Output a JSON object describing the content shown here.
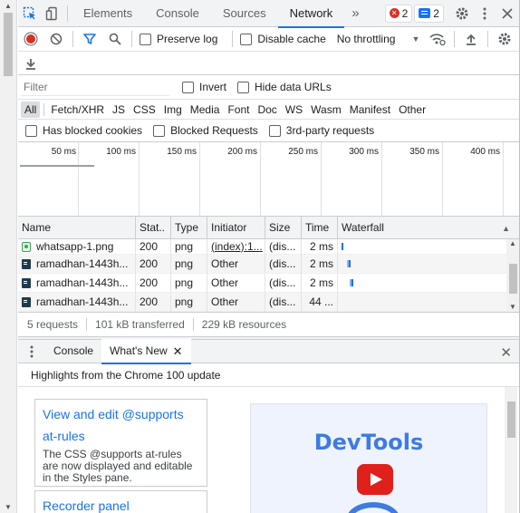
{
  "tabs": {
    "items": [
      "Elements",
      "Console",
      "Sources",
      "Network"
    ],
    "active": "Network",
    "more": "»",
    "error_count": "2",
    "message_count": "2"
  },
  "toolbar": {
    "preserve_log": "Preserve log",
    "disable_cache": "Disable cache",
    "throttling": "No throttling"
  },
  "filter": {
    "placeholder": "Filter",
    "invert": "Invert",
    "hide_data_urls": "Hide data URLs"
  },
  "type_filters": [
    "All",
    "Fetch/XHR",
    "JS",
    "CSS",
    "Img",
    "Media",
    "Font",
    "Doc",
    "WS",
    "Wasm",
    "Manifest",
    "Other"
  ],
  "blocked": {
    "has_blocked_cookies": "Has blocked cookies",
    "blocked_requests": "Blocked Requests",
    "third_party": "3rd-party requests"
  },
  "overview": {
    "ticks": [
      "50 ms",
      "100 ms",
      "150 ms",
      "200 ms",
      "250 ms",
      "300 ms",
      "350 ms",
      "400 ms"
    ]
  },
  "grid": {
    "headers": {
      "name": "Name",
      "status": "Stat..",
      "type": "Type",
      "initiator": "Initiator",
      "size": "Size",
      "time": "Time",
      "waterfall": "Waterfall"
    },
    "rows": [
      {
        "name": "whatsapp-1.png",
        "status": "200",
        "type": "png",
        "initiator": "(index):1...",
        "size": "(dis...",
        "time": "2 ms",
        "icon": "image-file-icon"
      },
      {
        "name": "ramadhan-1443h...",
        "status": "200",
        "type": "png",
        "initiator": "Other",
        "size": "(dis...",
        "time": "2 ms",
        "icon": "document-icon"
      },
      {
        "name": "ramadhan-1443h...",
        "status": "200",
        "type": "png",
        "initiator": "Other",
        "size": "(dis...",
        "time": "2 ms",
        "icon": "document-icon"
      },
      {
        "name": "ramadhan-1443h...",
        "status": "200",
        "type": "png",
        "initiator": "Other",
        "size": "(dis...",
        "time": "44 ...",
        "icon": "document-icon"
      }
    ]
  },
  "summary": {
    "requests": "5 requests",
    "transferred": "101 kB transferred",
    "resources": "229 kB resources"
  },
  "drawer": {
    "tabs": [
      "Console",
      "What's New"
    ],
    "active": "What's New",
    "header": "Highlights from the Chrome 100 update",
    "cards": [
      {
        "title_line1": "View and edit @supports",
        "title_line2": "at-rules",
        "text": "The CSS @supports at-rules are now displayed and editable in the Styles pane."
      },
      {
        "title_line1": "Recorder panel",
        "title_line2": "",
        "text": ""
      }
    ],
    "promo_title": "DevTools"
  },
  "colors": {
    "accent": "#1a73e8",
    "record_red": "#d93025",
    "promo_blue": "#3f7be0"
  }
}
